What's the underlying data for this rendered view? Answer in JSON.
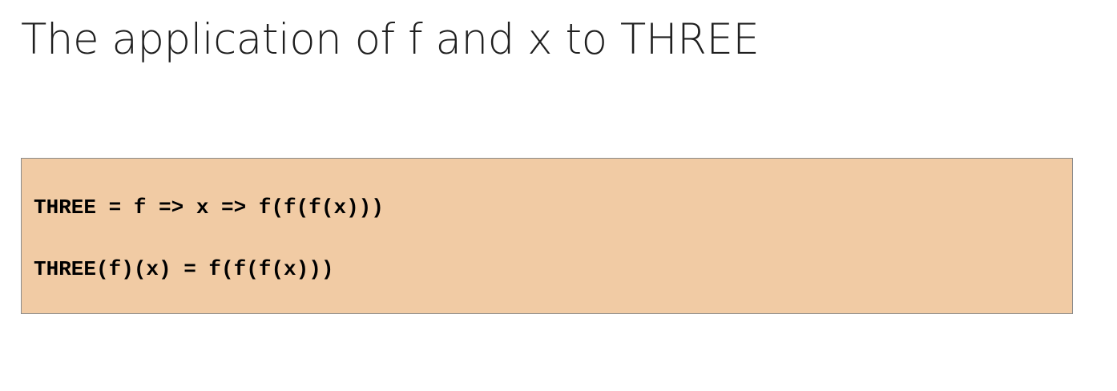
{
  "slide": {
    "title": "The application of f and x to THREE"
  },
  "code_block": {
    "background_color": "#f1cba4",
    "lines": [
      "THREE = f => x => f(f(f(x)))",
      "THREE(f)(x) = f(f(f(x)))"
    ]
  }
}
